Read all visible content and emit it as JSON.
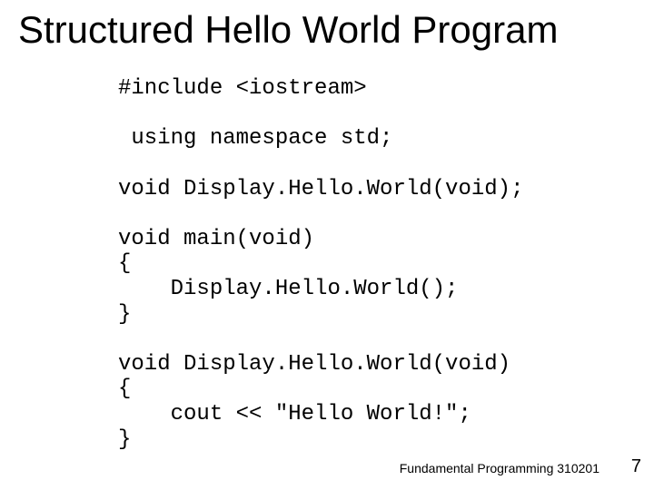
{
  "title": "Structured Hello World Program",
  "code": {
    "l1": "#include <iostream>",
    "l2": " using namespace std;",
    "l3": "void Display.Hello.World(void);",
    "l4": "void main(void)",
    "l5": "{",
    "l6": "    Display.Hello.World();",
    "l7": "}",
    "l8": "void Display.Hello.World(void)",
    "l9": "{",
    "l10": "    cout << \"Hello World!\";",
    "l11": "}"
  },
  "footer": "Fundamental Programming 310201",
  "page": "7"
}
